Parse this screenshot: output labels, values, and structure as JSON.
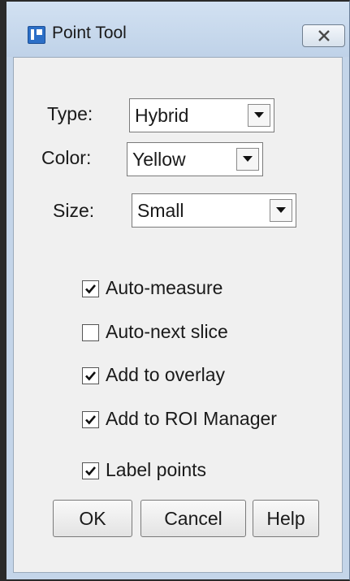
{
  "window": {
    "title": "Point Tool",
    "app_icon": "imagej-app-icon",
    "close_icon": "close-icon"
  },
  "fields": {
    "type": {
      "label": "Type:",
      "value": "Hybrid"
    },
    "color": {
      "label": "Color:",
      "value": "Yellow"
    },
    "size": {
      "label": "Size:",
      "value": "Small"
    }
  },
  "checkboxes": [
    {
      "label": "Auto-measure",
      "checked": true
    },
    {
      "label": "Auto-next slice",
      "checked": false
    },
    {
      "label": "Add to overlay",
      "checked": true
    },
    {
      "label": "Add to ROI Manager",
      "checked": true
    },
    {
      "label": "Label points",
      "checked": true
    }
  ],
  "buttons": {
    "ok": "OK",
    "cancel": "Cancel",
    "help": "Help"
  },
  "colors": {
    "titlebar": "#c4d5e9",
    "dialog_bg": "#f0f0f0",
    "app_icon": "#2c6fc7"
  }
}
